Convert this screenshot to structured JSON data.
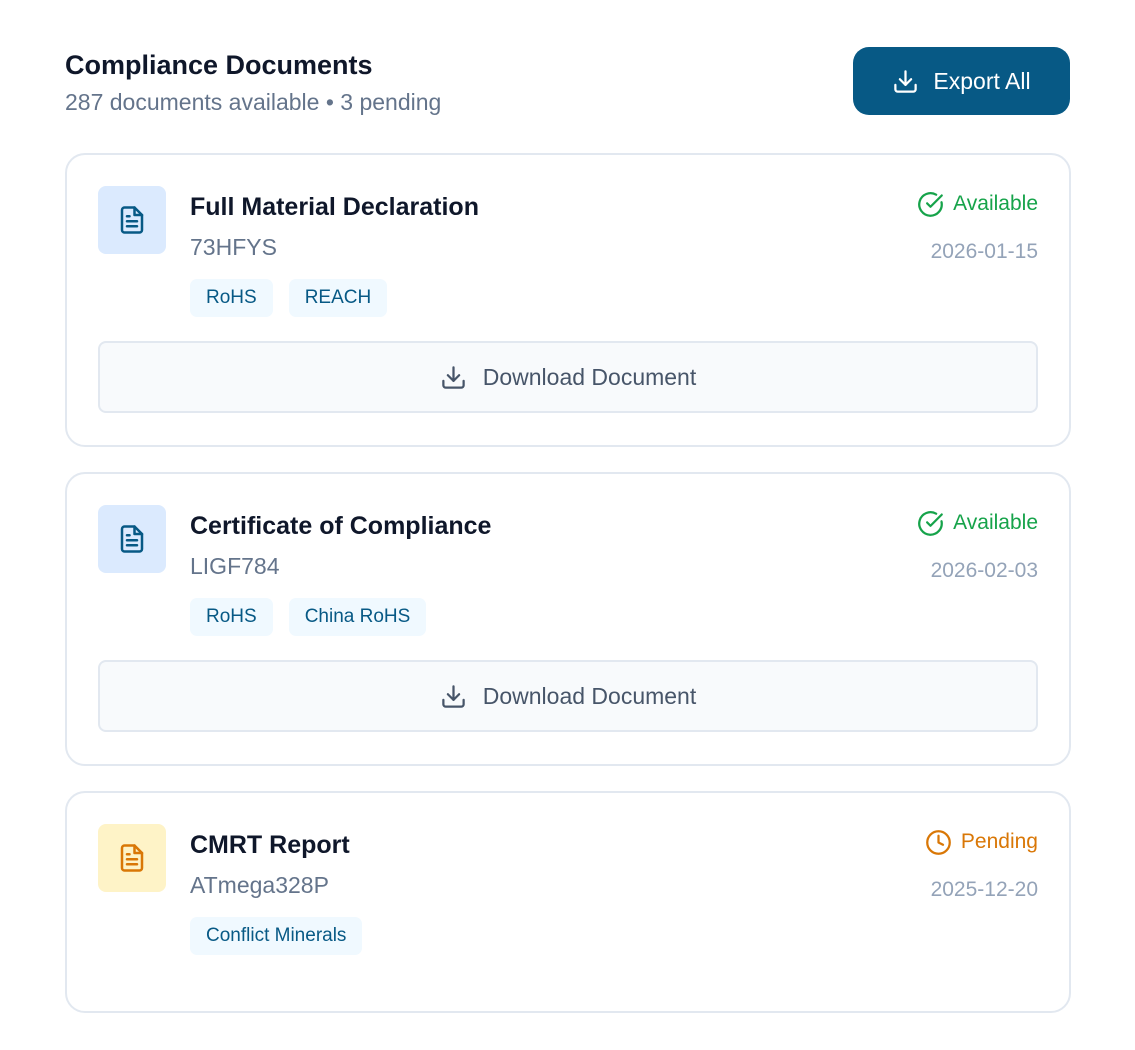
{
  "header": {
    "title": "Compliance Documents",
    "subtitle": "287 documents available • 3 pending",
    "export_label": "Export All"
  },
  "colors": {
    "accent": "#075985",
    "available": "#16a34a",
    "pending": "#d97706",
    "icon_bg_available": "#dbeafe",
    "icon_bg_pending": "#fef3c7"
  },
  "documents": [
    {
      "title": "Full Material Declaration",
      "part": "73HFYS",
      "tags": [
        "RoHS",
        "REACH"
      ],
      "status": "Available",
      "status_icon": "check-circle-icon",
      "date": "2026-01-15",
      "download_label": "Download Document"
    },
    {
      "title": "Certificate of Compliance",
      "part": "LIGF784",
      "tags": [
        "RoHS",
        "China RoHS"
      ],
      "status": "Available",
      "status_icon": "check-circle-icon",
      "date": "2026-02-03",
      "download_label": "Download Document"
    },
    {
      "title": "CMRT Report",
      "part": "ATmega328P",
      "tags": [
        "Conflict Minerals"
      ],
      "status": "Pending",
      "status_icon": "clock-icon",
      "date": "2025-12-20"
    }
  ]
}
